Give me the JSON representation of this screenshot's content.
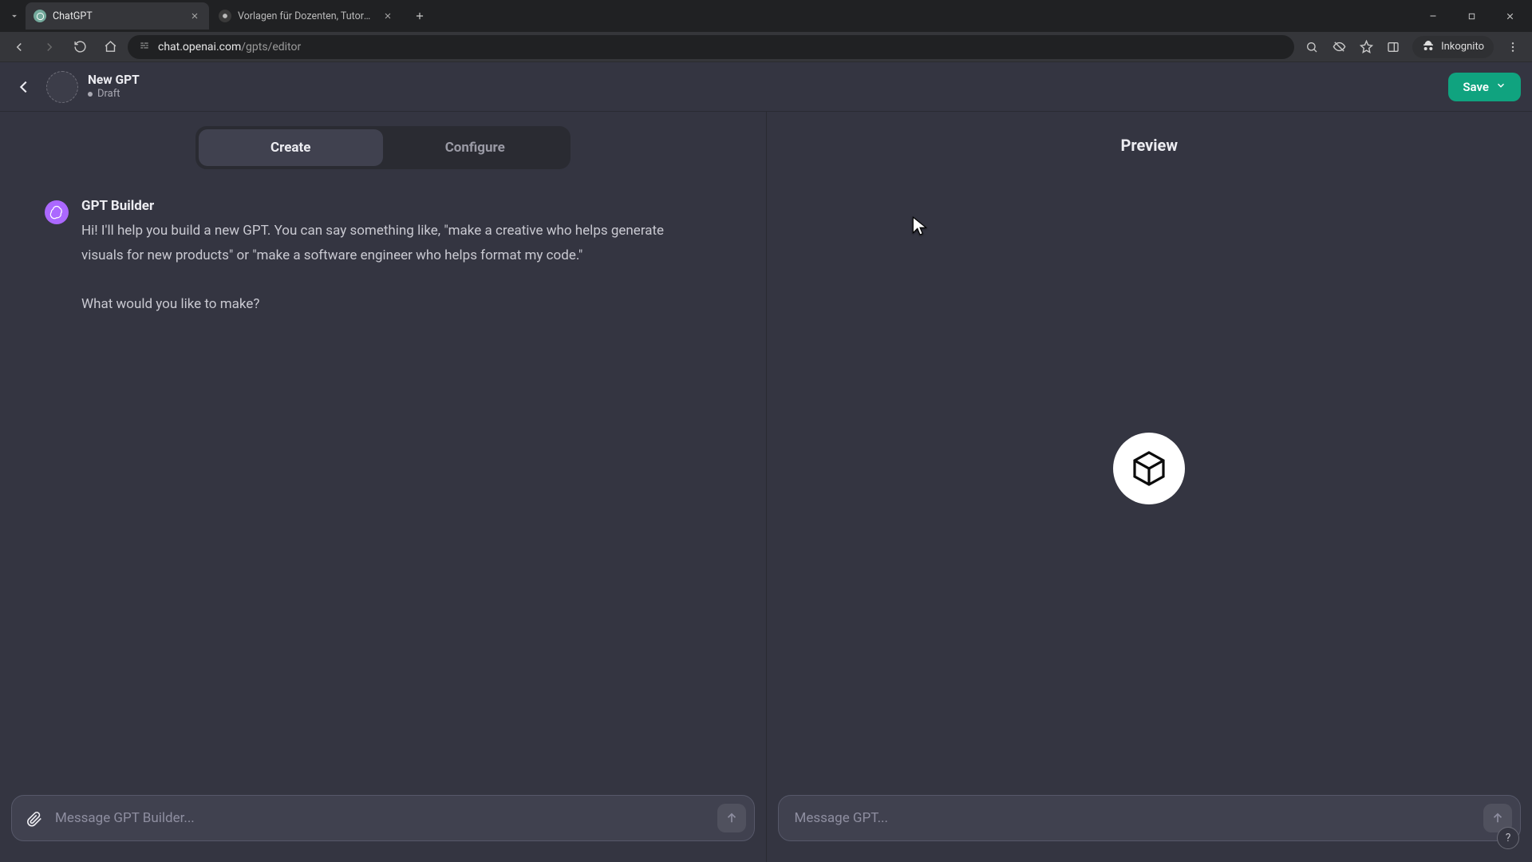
{
  "browser": {
    "tabs": [
      {
        "title": "ChatGPT",
        "favicon": "openai"
      },
      {
        "title": "Vorlagen für Dozenten, Tutore…",
        "favicon": "generic"
      }
    ],
    "url_host": "chat.openai.com",
    "url_path": "/gpts/editor",
    "incognito_label": "Inkognito"
  },
  "header": {
    "title": "New GPT",
    "status": "Draft",
    "save_label": "Save"
  },
  "left": {
    "tabs": {
      "create": "Create",
      "configure": "Configure",
      "active": "create"
    },
    "builder_name": "GPT Builder",
    "builder_message": "Hi! I'll help you build a new GPT. You can say something like, \"make a creative who helps generate visuals for new products\" or \"make a software engineer who helps format my code.\"\n\nWhat would you like to make?",
    "composer_placeholder": "Message GPT Builder..."
  },
  "right": {
    "preview_title": "Preview",
    "composer_placeholder": "Message GPT..."
  },
  "help_label": "?"
}
